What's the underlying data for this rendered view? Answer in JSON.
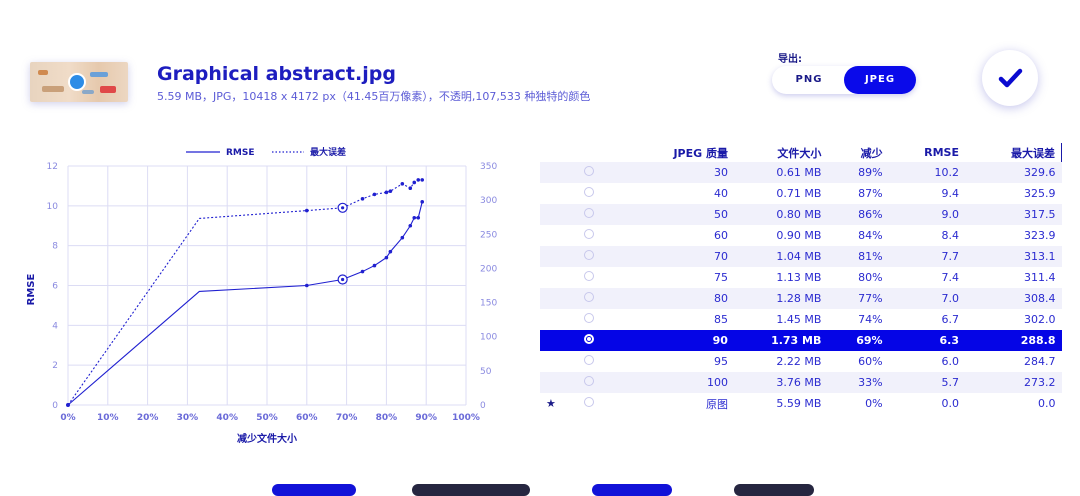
{
  "file": {
    "name": "Graphical abstract.jpg",
    "meta": "5.59 MB，JPG，10418 x 4172 px（41.45百万像素），不透明,107,533 种独特的颜色"
  },
  "export": {
    "label": "导出:",
    "formats": [
      "PNG",
      "JPEG"
    ],
    "selected": "JPEG"
  },
  "confirm_icon": "checkmark-icon",
  "chart_data": {
    "type": "line",
    "legend": [
      "RMSE",
      "最大误差"
    ],
    "legend_position": "top",
    "xlabel": "减少文件大小",
    "ylabel_left": "RMSE",
    "ylabel_right": "最大误差",
    "x_ticks": [
      "0%",
      "10%",
      "20%",
      "30%",
      "40%",
      "50%",
      "60%",
      "70%",
      "80%",
      "90%",
      "100%"
    ],
    "y_left_ticks": [
      "0",
      "2",
      "4",
      "6",
      "8",
      "10",
      "12"
    ],
    "y_right_ticks": [
      "0",
      "50",
      "100",
      "150",
      "200",
      "250",
      "300",
      "350"
    ],
    "ylim_left": [
      0,
      12
    ],
    "ylim_right": [
      0,
      350
    ],
    "xlim": [
      0,
      100
    ],
    "grid": true,
    "series": [
      {
        "name": "RMSE",
        "style": "solid",
        "x": [
          0,
          33,
          60,
          69,
          74,
          77,
          80,
          81,
          84,
          86,
          87,
          88,
          89
        ],
        "y": [
          0,
          5.7,
          6.0,
          6.3,
          6.7,
          7.0,
          7.4,
          7.7,
          8.4,
          9.0,
          9.4,
          9.4,
          10.2
        ]
      },
      {
        "name": "最大误差",
        "style": "dotted",
        "x": [
          0,
          33,
          60,
          69,
          74,
          77,
          80,
          81,
          84,
          86,
          87,
          88,
          89
        ],
        "y": [
          0,
          273.2,
          284.7,
          288.8,
          302.0,
          308.4,
          311.4,
          313.1,
          323.9,
          317.5,
          325.9,
          329.6,
          329.6
        ]
      }
    ],
    "highlight_x": 69
  },
  "table": {
    "headers": [
      "JPEG 质量",
      "文件大小",
      "减少",
      "RMSE",
      "最大误差"
    ],
    "rows": [
      {
        "quality": "30",
        "size": "0.61 MB",
        "reduce": "89%",
        "rmse": "10.2",
        "max": "329.6"
      },
      {
        "quality": "40",
        "size": "0.71 MB",
        "reduce": "87%",
        "rmse": "9.4",
        "max": "325.9"
      },
      {
        "quality": "50",
        "size": "0.80 MB",
        "reduce": "86%",
        "rmse": "9.0",
        "max": "317.5"
      },
      {
        "quality": "60",
        "size": "0.90 MB",
        "reduce": "84%",
        "rmse": "8.4",
        "max": "323.9"
      },
      {
        "quality": "70",
        "size": "1.04 MB",
        "reduce": "81%",
        "rmse": "7.7",
        "max": "313.1"
      },
      {
        "quality": "75",
        "size": "1.13 MB",
        "reduce": "80%",
        "rmse": "7.4",
        "max": "311.4"
      },
      {
        "quality": "80",
        "size": "1.28 MB",
        "reduce": "77%",
        "rmse": "7.0",
        "max": "308.4"
      },
      {
        "quality": "85",
        "size": "1.45 MB",
        "reduce": "74%",
        "rmse": "6.7",
        "max": "302.0"
      },
      {
        "quality": "90",
        "size": "1.73 MB",
        "reduce": "69%",
        "rmse": "6.3",
        "max": "288.8"
      },
      {
        "quality": "95",
        "size": "2.22 MB",
        "reduce": "60%",
        "rmse": "6.0",
        "max": "284.7"
      },
      {
        "quality": "100",
        "size": "3.76 MB",
        "reduce": "33%",
        "rmse": "5.7",
        "max": "273.2"
      },
      {
        "quality": "原图",
        "size": "5.59 MB",
        "reduce": "0%",
        "rmse": "0.0",
        "max": "0.0",
        "star": "★"
      }
    ],
    "selected_index": 8
  },
  "colors": {
    "accent": "#0a0aea",
    "selected_row": "#0505e6",
    "line": "#2020d0",
    "grid": "#dcdcf4"
  }
}
